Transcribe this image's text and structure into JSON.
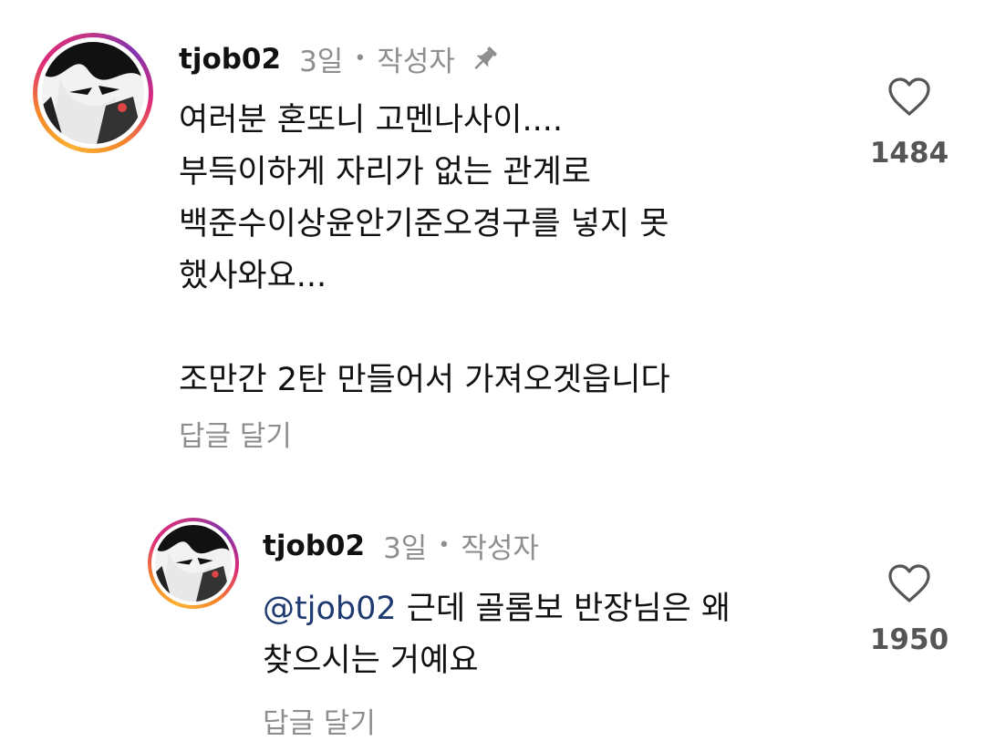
{
  "comments": [
    {
      "username": "tjob02",
      "time": "3일",
      "separator": "•",
      "author_badge": "작성자",
      "pinned_icon": "pin-icon",
      "lines": [
        "여러분 혼또니 고멘나사이....",
        "부득이하게 자리가 없는 관계로",
        "백준수이상윤안기준오경구를 넣지 못",
        "했사와요...",
        "",
        "조만간 2탄 만들어서 가져오겟읍니다"
      ],
      "reply_label": "답글 달기",
      "like_icon": "heart-outline-icon",
      "like_count": "1484"
    },
    {
      "username": "tjob02",
      "time": "3일",
      "separator": "•",
      "author_badge": "작성자",
      "mention": "@tjob02",
      "line1_rest": " 근데 골롬보 반장님은 왜",
      "line2": "찾으시는 거예요",
      "reply_label": "답글 달기",
      "like_icon": "heart-outline-icon",
      "like_count": "1950"
    }
  ],
  "colors": {
    "text": "#111111",
    "muted": "#8e8e8e",
    "mention": "#1f3a70",
    "avatar_ring": [
      "#f9b233",
      "#f58529",
      "#dd2a7b",
      "#8134af"
    ]
  }
}
